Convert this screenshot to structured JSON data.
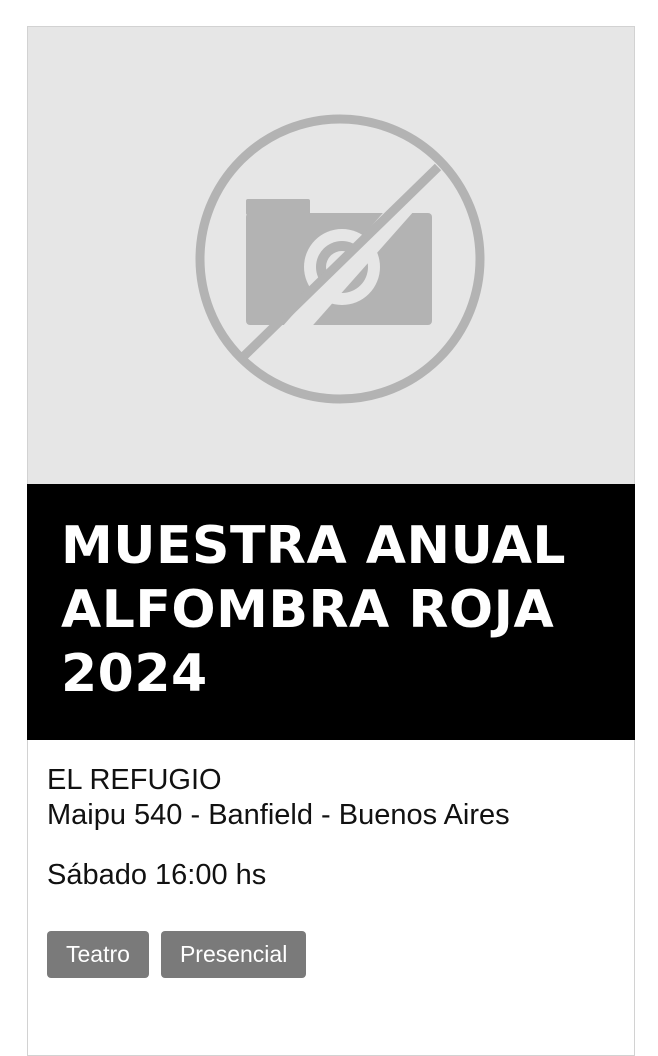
{
  "event": {
    "image": {
      "icon": "no-photo-icon",
      "background_color": "#e6e6e6",
      "icon_color": "#b3b3b3"
    },
    "title": "MUESTRA ANUAL ALFOMBRA ROJA 2024",
    "venue": {
      "name": "EL REFUGIO",
      "address": "Maipu 540 - Banfield - Buenos Aires"
    },
    "schedule": "Sábado 16:00 hs",
    "tags": [
      {
        "label": "Teatro"
      },
      {
        "label": "Presencial"
      }
    ]
  },
  "colors": {
    "title_band": "#000000",
    "title_text": "#ffffff",
    "tag_background": "#7a7a7a",
    "tag_text": "#ffffff"
  }
}
